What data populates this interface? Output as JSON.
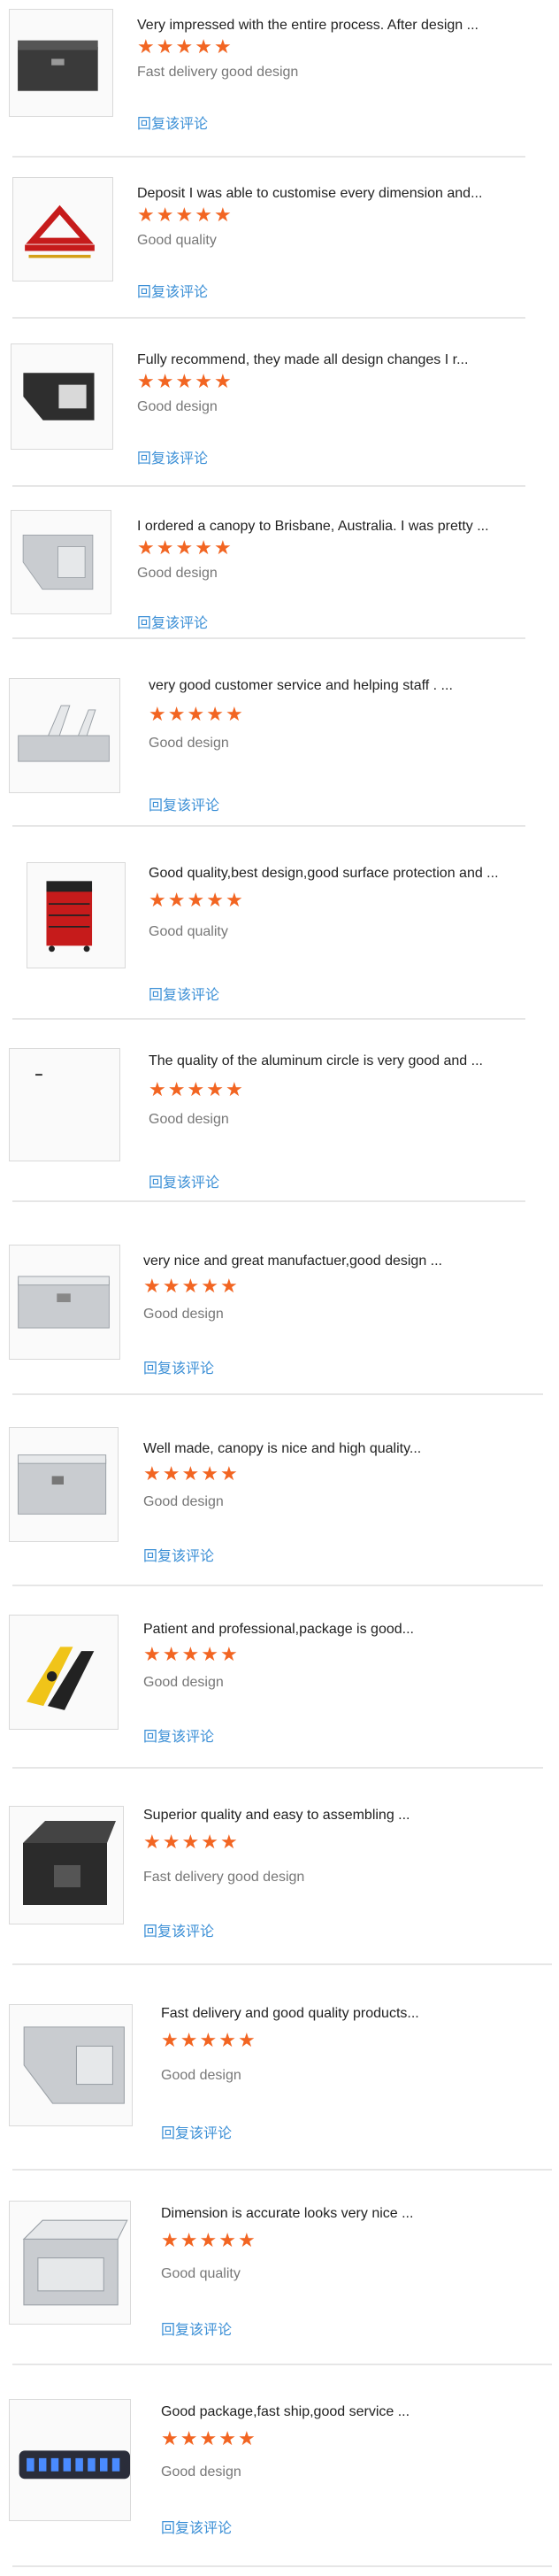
{
  "rating_max": 5,
  "star_color": "#f26522",
  "reply_color": "#3b8fd6",
  "reviews": [
    {
      "text": "Very impressed with the entire process. After design ...",
      "rating": 5,
      "tag": "Fast delivery good design",
      "reply": "回复该评论",
      "icon": "black-toolbox-icon"
    },
    {
      "text": "Deposit I was able to customise every dimension and...",
      "rating": 5,
      "tag": "Good quality",
      "reply": "回复该评论",
      "icon": "red-scissor-jack-icon"
    },
    {
      "text": "Fully recommend, they made all design changes I r...",
      "rating": 5,
      "tag": "Good design",
      "reply": "回复该评论",
      "icon": "black-underbody-box-icon"
    },
    {
      "text": "I ordered a canopy to Brisbane, Australia. I was pretty ...",
      "rating": 5,
      "tag": "Good design",
      "reply": "回复该评论",
      "icon": "aluminum-underbody-box-icon"
    },
    {
      "text": "very good customer service and helping staff .  ...",
      "rating": 5,
      "tag": "Good design",
      "reply": "回复该评论",
      "icon": "aluminum-chest-box-icon"
    },
    {
      "text": "Good quality,best design,good surface protection and ...",
      "rating": 5,
      "tag": "Good quality",
      "reply": "回复该评论",
      "icon": "red-tool-cabinet-icon"
    },
    {
      "text": "The quality of the aluminum circle is very good and ...",
      "rating": 5,
      "tag": "Good design",
      "reply": "回复该评论",
      "icon": "blank-product-icon"
    },
    {
      "text": "very nice and great manufactuer,good design ...",
      "rating": 5,
      "tag": "Good design",
      "reply": "回复该评论",
      "icon": "aluminum-toolbox-icon"
    },
    {
      "text": "Well made, canopy is nice and high quality...",
      "rating": 5,
      "tag": "Good design",
      "reply": "回复该评论",
      "icon": "checker-plate-box-icon"
    },
    {
      "text": "Patient and professional,package is good...",
      "rating": 5,
      "tag": "Good design",
      "reply": "回复该评论",
      "icon": "black-yellow-ramp-icon"
    },
    {
      "text": "Superior quality and easy to assembling ...",
      "rating": 5,
      "tag": "Fast delivery good design",
      "reply": "回复该评论",
      "icon": "black-steel-box-icon"
    },
    {
      "text": "Fast delivery and good quality products...",
      "rating": 5,
      "tag": "Good design",
      "reply": "回复该评论",
      "icon": "checker-plate-underbody-box-icon"
    },
    {
      "text": "Dimension is accurate looks very nice ...",
      "rating": 5,
      "tag": "Good quality",
      "reply": "回复该评论",
      "icon": "aluminum-drawer-box-icon"
    },
    {
      "text": "Good package,fast ship,good service ...",
      "rating": 5,
      "tag": "Good design",
      "reply": "回复该评论",
      "icon": "led-light-bar-icon"
    }
  ]
}
